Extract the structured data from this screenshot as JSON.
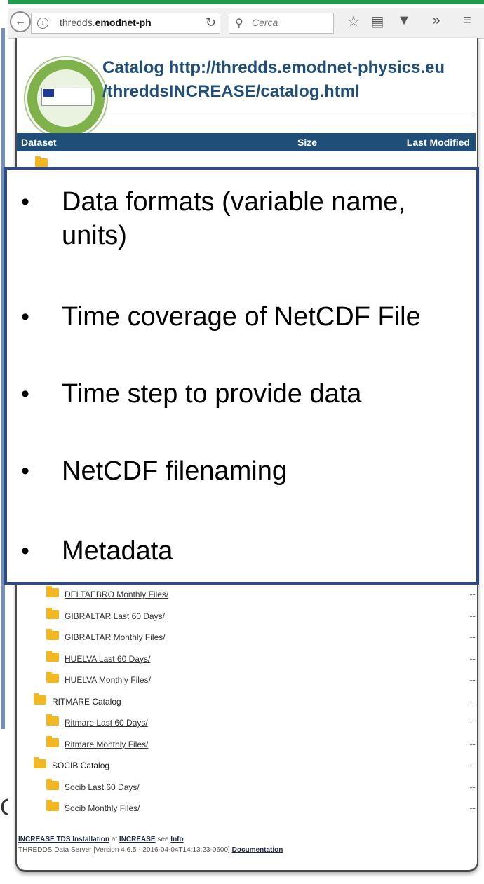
{
  "browser": {
    "url_prefix": "thredds.",
    "url_domain": "emodnet-ph",
    "search_placeholder": "Cerca",
    "back_icon": "back-arrow-icon",
    "info_icon": "info-icon",
    "reload_icon": "reload-icon",
    "bookmark_icon": "star-icon",
    "reader_icon": "clipboard-icon",
    "pocket_icon": "pocket-icon",
    "overflow_icon": "chevrons-right-icon",
    "menu_icon": "hamburger-menu-icon"
  },
  "catalog": {
    "title_line1": "Catalog http://thredds.emodnet-physics.eu",
    "title_line2": "/threddsINCREASE/catalog.html",
    "columns": {
      "dataset": "Dataset",
      "size": "Size",
      "modified": "Last Modified"
    },
    "rows": [
      {
        "label": "DELTAEBRO Monthly Files/",
        "link": true,
        "indent": 1,
        "value": "--"
      },
      {
        "label": "GIBRALTAR Last 60 Days/",
        "link": true,
        "indent": 1,
        "value": "--"
      },
      {
        "label": "GIBRALTAR Monthly Files/",
        "link": true,
        "indent": 1,
        "value": "--"
      },
      {
        "label": "HUELVA Last 60 Days/",
        "link": true,
        "indent": 1,
        "value": "--"
      },
      {
        "label": "HUELVA Monthly Files/",
        "link": true,
        "indent": 1,
        "value": "--"
      },
      {
        "label": "RITMARE Catalog",
        "link": false,
        "indent": 0,
        "value": "--"
      },
      {
        "label": "Ritmare Last 60 Days/",
        "link": true,
        "indent": 1,
        "value": "--"
      },
      {
        "label": "Ritmare Monthly Files/",
        "link": true,
        "indent": 1,
        "value": "--"
      },
      {
        "label": "SOCIB Catalog",
        "link": false,
        "indent": 0,
        "value": "--"
      },
      {
        "label": "Socib Last 60 Days/",
        "link": true,
        "indent": 1,
        "value": "--"
      },
      {
        "label": "Socib Monthly Files/",
        "link": true,
        "indent": 1,
        "value": "--"
      }
    ],
    "footer": {
      "installation": "INCREASE TDS Installation",
      "at": "at",
      "increase": "INCREASE",
      "see": "see",
      "info": "Info",
      "server": "THREDDS Data Server [Version 4.6.5 - 2016-04-04T14:13:23-0600]",
      "documentation": "Documentation"
    }
  },
  "callout": {
    "bullets": [
      "Data formats (variable name, units)",
      "Time coverage of NetCDF File",
      "Time step to provide data",
      "NetCDF filenaming",
      "Metadata"
    ]
  },
  "colors": {
    "header_bar": "#1f4e79",
    "title_text": "#1f4e79",
    "callout_border": "#2d4a86",
    "folder": "#f1b824"
  }
}
